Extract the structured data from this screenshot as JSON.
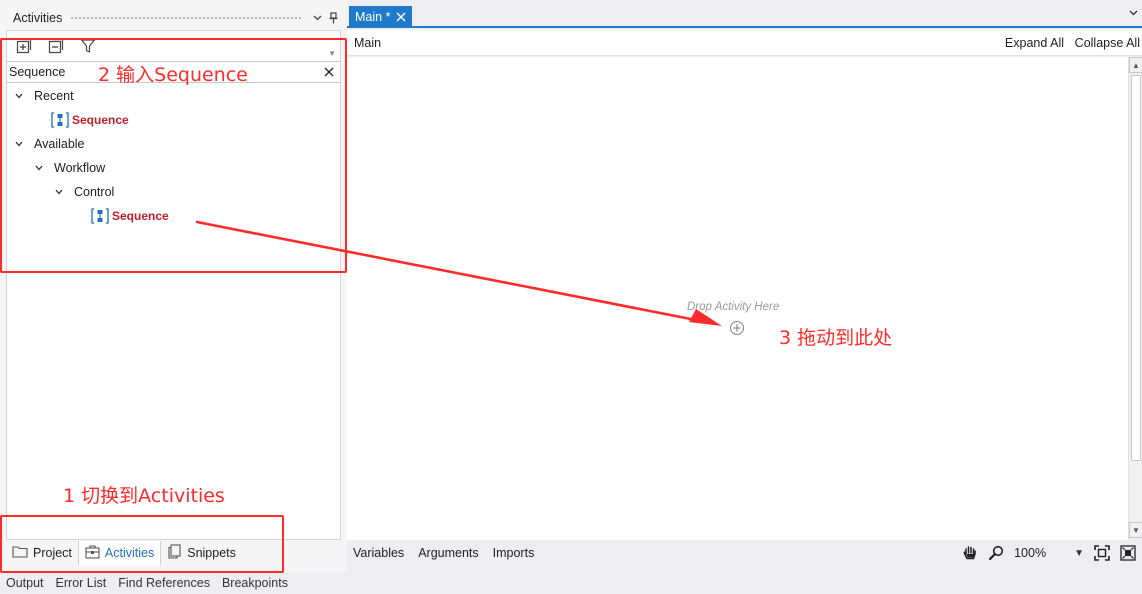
{
  "left_panel": {
    "title": "Activities",
    "search_value": "Sequence",
    "tree": {
      "recent_label": "Recent",
      "recent_item": "Sequence",
      "available_label": "Available",
      "workflow_label": "Workflow",
      "control_label": "Control",
      "control_item": "Sequence"
    },
    "tabs": {
      "project": "Project",
      "activities": "Activities",
      "snippets": "Snippets"
    }
  },
  "status_tabs": [
    "Output",
    "Error List",
    "Find References",
    "Breakpoints"
  ],
  "designer": {
    "tab_label": "Main *",
    "breadcrumb": "Main",
    "expand_all": "Expand All",
    "collapse_all": "Collapse All",
    "drop_hint": "Drop Activity Here",
    "footer_tabs": {
      "variables": "Variables",
      "arguments": "Arguments",
      "imports": "Imports"
    },
    "zoom": "100%"
  },
  "annotations": {
    "step1": "1 切换到Activities",
    "step2": "2 输入Sequence",
    "step3": "3 拖动到此处",
    "color": "#ff2a2a"
  },
  "colors": {
    "accent": "#1f7acc",
    "activity_text": "#c0202a"
  }
}
